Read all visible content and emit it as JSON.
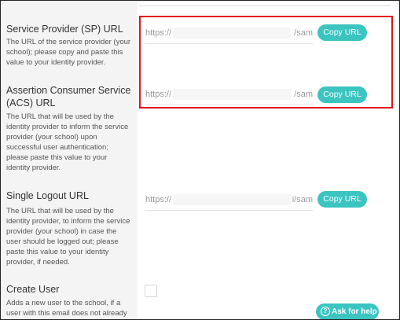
{
  "sections": [
    {
      "title": "Service Provider (SP) URL",
      "description": "The URL of the service provider (your school); please copy and paste this value to your identity provider.",
      "url_prefix": "https://",
      "url_suffix": "/sam",
      "button": "Copy URL"
    },
    {
      "title": "Assertion Consumer Service (ACS) URL",
      "description": "The URL that will be used by the identity provider to inform the service provider (your school) upon successful user authentication; please paste this value to your identity provider.",
      "url_prefix": "https://",
      "url_suffix": "/sam",
      "button": "Copy URL"
    },
    {
      "title": "Single Logout URL",
      "description": "The URL that will be used by the identity provider, to inform the service provider (your school) in case the user should be logged out; please paste this value to your identity provider, if needed.",
      "url_prefix": "https://",
      "url_suffix": "i/sam",
      "button": "Copy URL"
    },
    {
      "title": "Create User",
      "description": "Adds a new user to the school, if a user with this email does not already"
    }
  ],
  "help_button": {
    "label": "Ask for help",
    "icon": "question-circle-icon"
  },
  "colors": {
    "accent": "#3cc4c1",
    "highlight": "#e1121b"
  }
}
